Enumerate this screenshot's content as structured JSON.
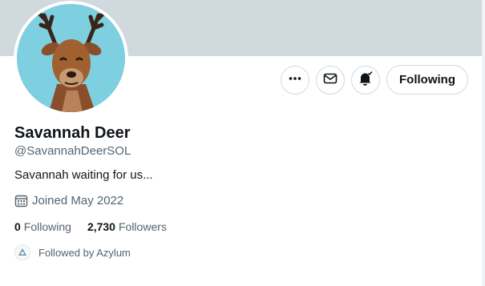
{
  "profile": {
    "display_name": "Savannah Deer",
    "handle": "@SavannahDeerSOL",
    "bio": "Savannah waiting for us...",
    "joined": "Joined May 2022"
  },
  "stats": {
    "following_count": "0",
    "following_label": "Following",
    "followers_count": "2,730",
    "followers_label": "Followers"
  },
  "followed_by": {
    "text": "Followed by Azylum"
  },
  "actions": {
    "follow_button_label": "Following",
    "more_icon": "more-icon",
    "message_icon": "envelope-icon",
    "notify_icon": "bell-check-icon"
  },
  "colors": {
    "banner": "#cfd9de",
    "avatar_bg": "#7ecfe0",
    "text_primary": "#0f1419",
    "text_secondary": "#536471",
    "border": "#cfd9de"
  }
}
